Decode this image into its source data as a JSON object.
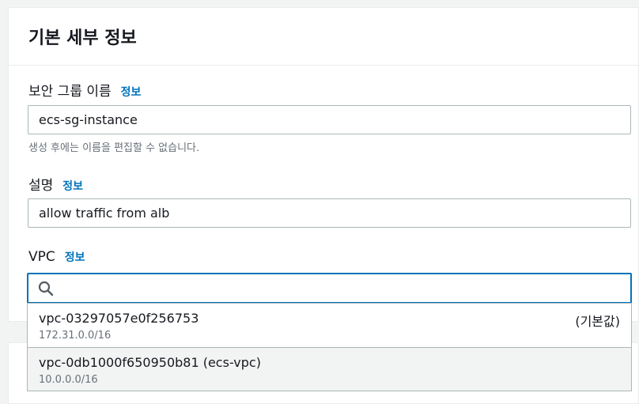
{
  "panel": {
    "title": "기본 세부 정보",
    "info_label": "정보"
  },
  "security_group_name": {
    "label": "보안 그룹 이름",
    "value": "ecs-sg-instance",
    "hint": "생성 후에는 이름을 편집할 수 없습니다."
  },
  "description": {
    "label": "설명",
    "value": "allow traffic from alb"
  },
  "vpc": {
    "label": "VPC",
    "search_value": "",
    "options": [
      {
        "id": "vpc-03297057e0f256753",
        "cidr": "172.31.0.0/16",
        "tag": "(기본값)"
      },
      {
        "id": "vpc-0db1000f650950b81 (ecs-vpc)",
        "cidr": "10.0.0.0/16",
        "tag": ""
      }
    ]
  },
  "colors": {
    "link": "#0073bb",
    "focus_border": "#0073bb",
    "hint_text": "#687078"
  },
  "icons": {
    "search": "search-icon"
  }
}
